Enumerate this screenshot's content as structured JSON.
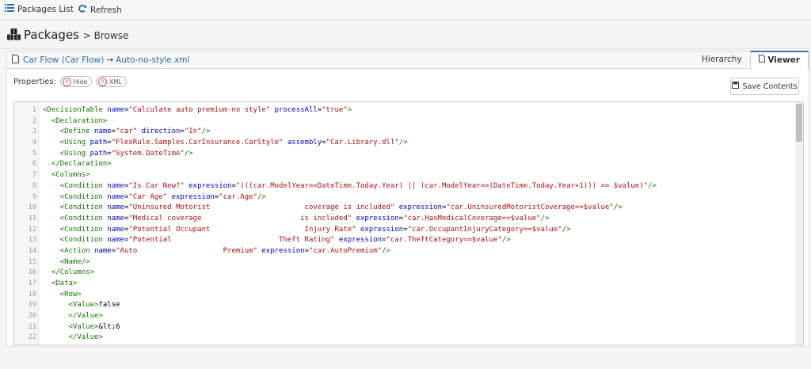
{
  "topbar": {
    "packages_list": "Packages List",
    "refresh": "Refresh"
  },
  "header": {
    "title": "Packages",
    "subtitle": "> Browse"
  },
  "panel": {
    "breadcrumb_link": "Car Flow (Car Flow)",
    "arrow": "→",
    "file_link": "Auto-no-style.xml",
    "tabs": [
      "Hierarchy",
      "Viewer"
    ],
    "properties_label": "Properties:",
    "pill_hide": "Hide",
    "pill_xml": "XML",
    "save_button": "Save Contents"
  },
  "code_lines": [
    {
      "n": "1",
      "t": [
        [
          "tag",
          "<DecisionTable "
        ],
        [
          "attr",
          "name"
        ],
        [
          "plain",
          "="
        ],
        [
          "val",
          "\"Calculate auto premium-no style\""
        ],
        [
          "attr",
          " processAll"
        ],
        [
          "plain",
          "="
        ],
        [
          "val",
          "\"true\""
        ],
        [
          "tag",
          ">"
        ]
      ]
    },
    {
      "n": "2",
      "t": [
        [
          "tag",
          "  <Declaration>"
        ]
      ]
    },
    {
      "n": "3",
      "t": [
        [
          "tag",
          "    <Define "
        ],
        [
          "attr",
          "name"
        ],
        [
          "plain",
          "="
        ],
        [
          "val",
          "\"car\""
        ],
        [
          "attr",
          " direction"
        ],
        [
          "plain",
          "="
        ],
        [
          "val",
          "\"In\""
        ],
        [
          "tag",
          "/>"
        ]
      ]
    },
    {
      "n": "4",
      "t": [
        [
          "tag",
          "    <Using "
        ],
        [
          "attr",
          "path"
        ],
        [
          "plain",
          "="
        ],
        [
          "val",
          "\"FlexRule.Samples.CarInsurance.CarStyle\""
        ],
        [
          "attr",
          " assembly"
        ],
        [
          "plain",
          "="
        ],
        [
          "val",
          "\"Car.Library.dll\""
        ],
        [
          "tag",
          "/>"
        ]
      ]
    },
    {
      "n": "5",
      "t": [
        [
          "tag",
          "    <Using "
        ],
        [
          "attr",
          "path"
        ],
        [
          "plain",
          "="
        ],
        [
          "val",
          "\"System.DateTime\""
        ],
        [
          "tag",
          "/>"
        ]
      ]
    },
    {
      "n": "6",
      "t": [
        [
          "tag",
          "  </Declaration>"
        ]
      ]
    },
    {
      "n": "7",
      "t": [
        [
          "tag",
          "  <Columns>"
        ]
      ]
    },
    {
      "n": "8",
      "t": [
        [
          "tag",
          "    <Condition "
        ],
        [
          "attr",
          "name"
        ],
        [
          "plain",
          "="
        ],
        [
          "val",
          "\"Is Car New?\""
        ],
        [
          "attr",
          " expression"
        ],
        [
          "plain",
          "="
        ],
        [
          "val",
          "\"(((car.ModelYear==DateTime.Today.Year) || (car.ModelYear==(DateTime.Today.Year+1))) == $value)\""
        ],
        [
          "tag",
          "/>"
        ]
      ]
    },
    {
      "n": "9",
      "t": [
        [
          "tag",
          "    <Condition "
        ],
        [
          "attr",
          "name"
        ],
        [
          "plain",
          "="
        ],
        [
          "val",
          "\"Car Age\""
        ],
        [
          "attr",
          " expression"
        ],
        [
          "plain",
          "="
        ],
        [
          "val",
          "\"car.Age\""
        ],
        [
          "tag",
          "/>"
        ]
      ]
    },
    {
      "n": "10",
      "t": [
        [
          "tag",
          "    <Condition "
        ],
        [
          "attr",
          "name"
        ],
        [
          "plain",
          "="
        ],
        [
          "val",
          "\"Uninsured Motorist                      coverage is included\""
        ],
        [
          "attr",
          " expression"
        ],
        [
          "plain",
          "="
        ],
        [
          "val",
          "\"car.UninsuredMotoristCoverage==$value\""
        ],
        [
          "tag",
          "/>"
        ]
      ]
    },
    {
      "n": "11",
      "t": [
        [
          "tag",
          "    <Condition "
        ],
        [
          "attr",
          "name"
        ],
        [
          "plain",
          "="
        ],
        [
          "val",
          "\"Medical coverage                       is included\""
        ],
        [
          "attr",
          " expression"
        ],
        [
          "plain",
          "="
        ],
        [
          "val",
          "\"car.HasMedicalCoverage==$value\""
        ],
        [
          "tag",
          "/>"
        ]
      ]
    },
    {
      "n": "12",
      "t": [
        [
          "tag",
          "    <Condition "
        ],
        [
          "attr",
          "name"
        ],
        [
          "plain",
          "="
        ],
        [
          "val",
          "\"Potential Occupant                      Injury Rate\""
        ],
        [
          "attr",
          " expression"
        ],
        [
          "plain",
          "="
        ],
        [
          "val",
          "\"car.OccupantInjuryCategory==$value\""
        ],
        [
          "tag",
          "/>"
        ]
      ]
    },
    {
      "n": "13",
      "t": [
        [
          "tag",
          "    <Condition "
        ],
        [
          "attr",
          "name"
        ],
        [
          "plain",
          "="
        ],
        [
          "val",
          "\"Potential                         Theft Rating\""
        ],
        [
          "attr",
          " expression"
        ],
        [
          "plain",
          "="
        ],
        [
          "val",
          "\"car.TheftCategory==$value\""
        ],
        [
          "tag",
          "/>"
        ]
      ]
    },
    {
      "n": "14",
      "t": [
        [
          "tag",
          "    <Action "
        ],
        [
          "attr",
          "name"
        ],
        [
          "plain",
          "="
        ],
        [
          "val",
          "\"Auto                    Premium\""
        ],
        [
          "attr",
          " expression"
        ],
        [
          "plain",
          "="
        ],
        [
          "val",
          "\"car.AutoPremium\""
        ],
        [
          "tag",
          "/>"
        ]
      ]
    },
    {
      "n": "15",
      "t": [
        [
          "tag",
          "    <Name/>"
        ]
      ]
    },
    {
      "n": "16",
      "t": [
        [
          "tag",
          "  </Columns>"
        ]
      ]
    },
    {
      "n": "17",
      "t": [
        [
          "tag",
          "  <Data>"
        ]
      ]
    },
    {
      "n": "18",
      "t": [
        [
          "tag",
          "    <Row>"
        ]
      ]
    },
    {
      "n": "19",
      "t": [
        [
          "tag",
          "      <Value>"
        ],
        [
          "plain",
          "false"
        ]
      ]
    },
    {
      "n": "20",
      "t": [
        [
          "tag",
          "      </Value>"
        ]
      ]
    },
    {
      "n": "21",
      "t": [
        [
          "tag",
          "      <Value>"
        ],
        [
          "plain",
          "&lt;6"
        ]
      ]
    },
    {
      "n": "22",
      "t": [
        [
          "tag",
          "      </Value>"
        ]
      ]
    }
  ]
}
